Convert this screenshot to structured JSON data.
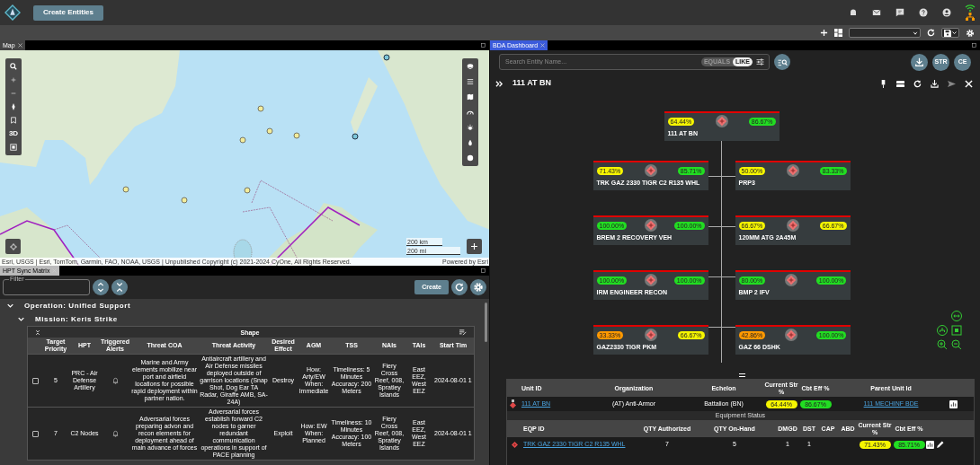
{
  "top_bar": {
    "create_button": "Create Entities"
  },
  "map_panel": {
    "tab": "Map",
    "view_toggle": "3D",
    "scale": [
      "200 km",
      "200 mi"
    ],
    "attribution": "Esri, USGS | Esri, TomTom, Garmin, FAO, NOAA, USGS | Unpublished Copyright (c) 2021-2024 CyOne, All Rights Reserved.",
    "powered_by": "Powered by Esri"
  },
  "hpt_panel": {
    "tab": "HPT Sync Matrix",
    "filter_label": "Filter",
    "create_button": "Create",
    "operation": "Operation: Unified Support",
    "mission": "Mission: Keris Strike",
    "group_title": "Shape",
    "columns": [
      "",
      "Target Priority",
      "HPT",
      "Triggered Alerts",
      "Threat COA",
      "Threat Activity",
      "Desired Effect",
      "AGM",
      "TSS",
      "NAIs",
      "TAIs",
      "Start Tim"
    ],
    "rows": [
      {
        "checked": false,
        "cells": [
          "",
          "5",
          "PRC - Air Defense Artillery",
          "",
          "Marine and Army elements mobilize near port and airfield locations for possible rapid deployment within partner nation.",
          "Antiaircraft artillery and Air Defense missiles deployed outside of garrison locations (Snap Shot, Dog Ear TA Radar, Giraffe AMB, SA-24A)",
          "Destroy",
          "How: Arty/EW When: Immediate",
          "Timeliness: 5 Minutes Accuracy: 200 Meters",
          "Fiery Cross Reef, 008, Spratley Islands",
          "East EEZ, West EEZ",
          "2024-08-01 1"
        ]
      },
      {
        "checked": false,
        "cells": [
          "",
          "7",
          "C2 Nodes",
          "",
          "Adversarial forces preparing advon and recon elements for deployment ahead of main advance of forces",
          "Adversarial forces establish forward C2 nodes to garner redundant communication operations in support of PACE planning",
          "Exploit",
          "How: EW When: Planned",
          "Timeliness: 10 Minutes Accuracy: 100 Meters",
          "Fiery Cross Reef, 008, Spratley Islands",
          "East EEZ, West EEZ",
          "2024-08-01 1"
        ]
      }
    ]
  },
  "bda_panel": {
    "tab": "BDA Dashboard",
    "search_placeholder": "Search Entity Name...",
    "match_modes": [
      {
        "label": "EQUALS",
        "selected": false
      },
      {
        "label": "LIKE",
        "selected": true
      }
    ],
    "round_buttons": [
      "STR",
      "CE"
    ],
    "title": "111 AT BN",
    "org_root": {
      "name": "111 AT BN",
      "badges": [
        {
          "text": "64.44%",
          "color": "#f5f500"
        },
        {
          "text": "86.67%",
          "color": "#22dd22"
        }
      ]
    },
    "org_children": [
      {
        "name": "TRK GAZ 2330 TIGR C2 R135 WHL",
        "badges": [
          {
            "text": "71.43%",
            "color": "#f5f500"
          },
          {
            "text": "85.71%",
            "color": "#22dd22"
          }
        ]
      },
      {
        "name": "PRP3",
        "badges": [
          {
            "text": "50.00%",
            "color": "#f5f500"
          },
          {
            "text": "83.33%",
            "color": "#22dd22"
          }
        ]
      },
      {
        "name": "BREM 2 RECOVERY VEH",
        "badges": [
          {
            "text": "100.00%",
            "color": "#22dd22"
          },
          {
            "text": "100.00%",
            "color": "#22dd22"
          }
        ]
      },
      {
        "name": "120MM ATG 2A45M",
        "badges": [
          {
            "text": "66.67%",
            "color": "#f5f500"
          },
          {
            "text": "66.67%",
            "color": "#f5f500"
          }
        ]
      },
      {
        "name": "IRM ENGINEER RECON",
        "badges": [
          {
            "text": "100.00%",
            "color": "#22dd22"
          },
          {
            "text": "100.00%",
            "color": "#22dd22"
          }
        ]
      },
      {
        "name": "BMP 2 IFV",
        "badges": [
          {
            "text": "80.00%",
            "color": "#22dd22"
          },
          {
            "text": "100.00%",
            "color": "#22dd22"
          }
        ]
      },
      {
        "name": "GAZ2330 TIGR PKM",
        "badges": [
          {
            "text": "33.33%",
            "color": "#ff9900"
          },
          {
            "text": "66.67%",
            "color": "#f5f500"
          }
        ]
      },
      {
        "name": "GAZ 66 DSHK",
        "badges": [
          {
            "text": "42.86%",
            "color": "#ff9900"
          },
          {
            "text": "100.00%",
            "color": "#22dd22"
          }
        ]
      }
    ],
    "unit_table": {
      "columns": [
        "Unit ID",
        "Organization",
        "Echelon",
        "Current Str %",
        "Cbt Eff %",
        "Parent Unit Id"
      ],
      "row": {
        "unit_id": "111 AT BN",
        "organization": "(AT) Anti-Armor",
        "echelon": "Battalion (BN)",
        "current_str": {
          "text": "64.44%",
          "color": "#f5f500"
        },
        "cbt_eff": {
          "text": "86.67%",
          "color": "#22dd22"
        },
        "parent": "111 MECHINF BDE"
      }
    },
    "equipment_title": "Equipment Status",
    "equipment_table": {
      "columns": [
        "EQP ID",
        "QTY Authorized",
        "QTY On-Hand",
        "DMGD",
        "DST",
        "CAP",
        "ABD",
        "Current Str %",
        "Cbt Eff %"
      ],
      "rows": [
        {
          "eqp_id": "TRK GAZ 2330 TIGR C2 R135 WHL",
          "authorized": "7",
          "on_hand": "5",
          "dmgd": "1",
          "dst": "1",
          "current_str": {
            "text": "71.43%",
            "color": "#f5f500"
          },
          "cbt_eff": {
            "text": "85.71%",
            "color": "#22dd22"
          }
        }
      ]
    }
  }
}
